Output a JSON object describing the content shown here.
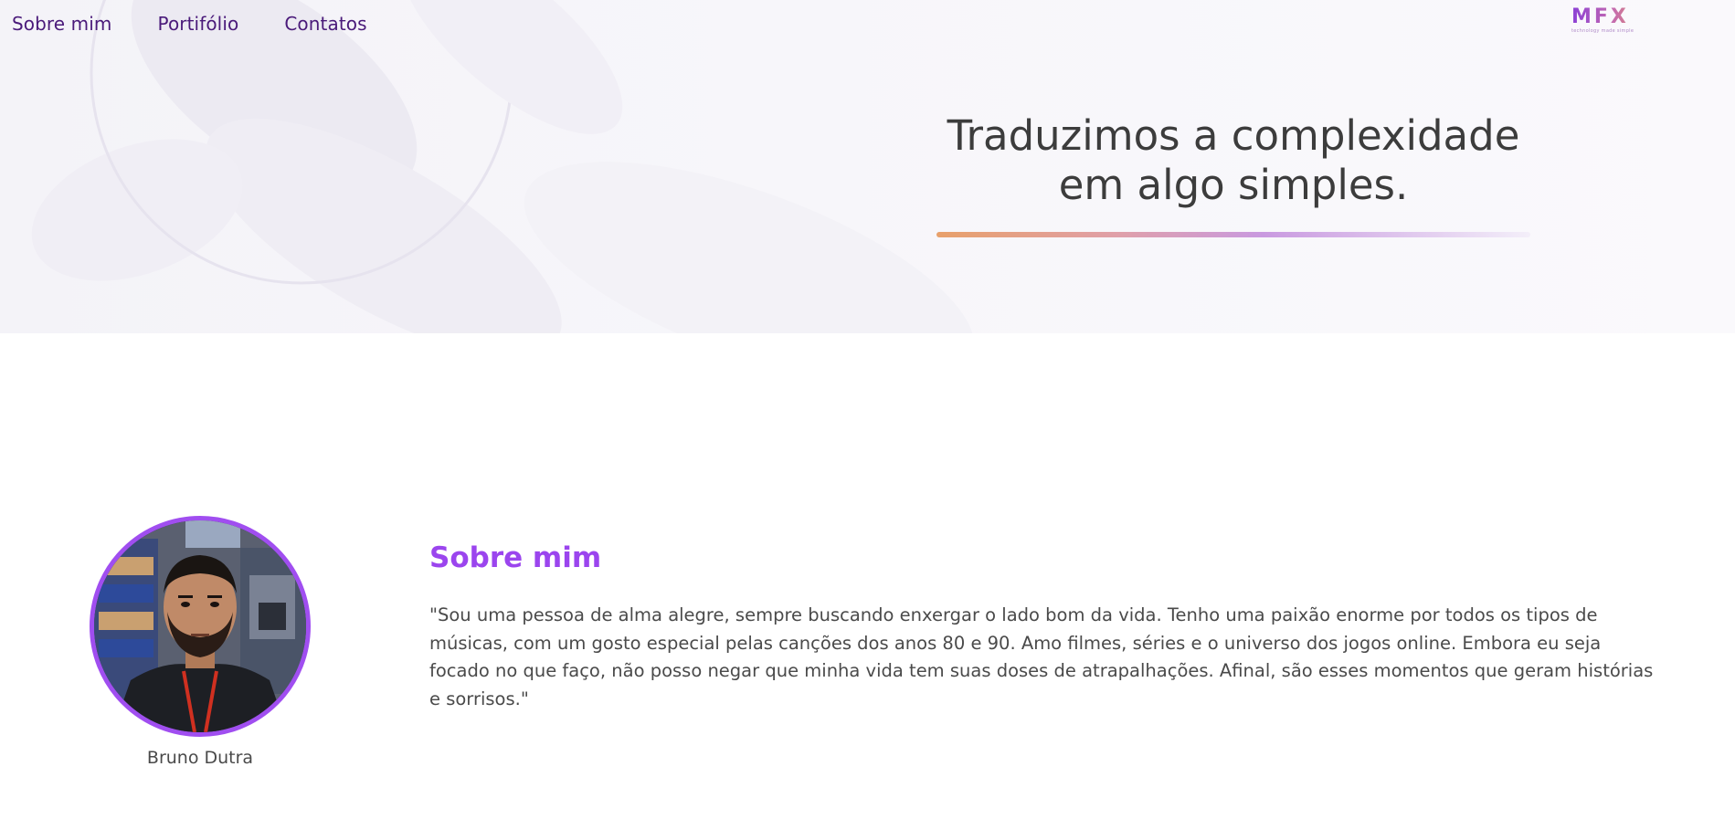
{
  "nav": {
    "items": [
      {
        "label": "Sobre mim"
      },
      {
        "label": "Portifólio"
      },
      {
        "label": "Contatos"
      }
    ]
  },
  "logo": {
    "mark": "MFX",
    "tagline": "technology made simple"
  },
  "hero": {
    "tagline_line1": "Traduzimos a complexidade",
    "tagline_line2": "em algo simples."
  },
  "about": {
    "title": "Sobre mim",
    "text": "\"Sou uma pessoa de alma alegre, sempre buscando enxergar o lado bom da vida. Tenho uma paixão enorme por todos os tipos de músicas, com um gosto especial pelas canções dos anos 80 e 90. Amo filmes, séries e o universo dos jogos online. Embora eu seja focado no que faço, não posso negar que minha vida tem suas doses de atrapalhações. Afinal, são esses momentos que geram histórias e sorrisos.\"",
    "name": "Bruno Dutra"
  },
  "colors": {
    "accent": "#9b45ee",
    "nav_text": "#4a1a7a",
    "body_text": "#4a4a4a"
  }
}
